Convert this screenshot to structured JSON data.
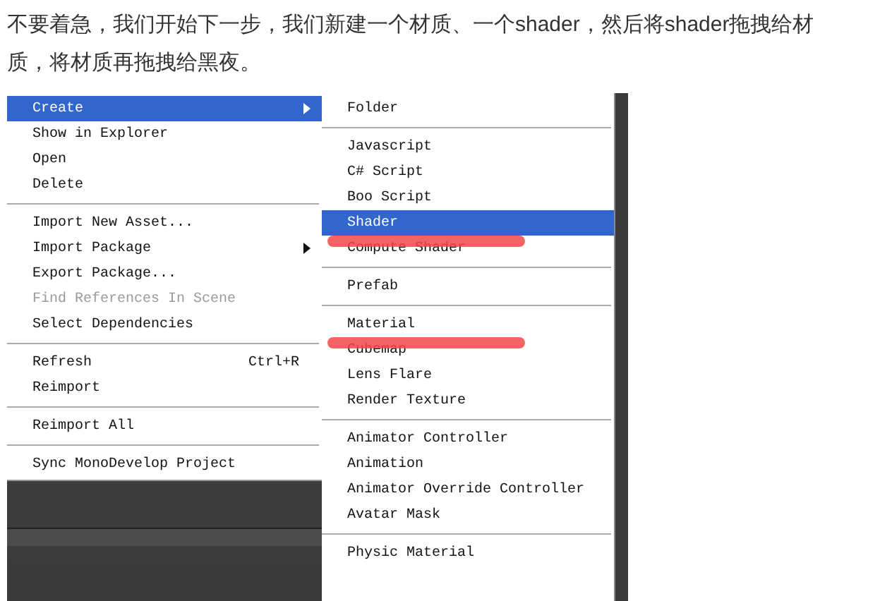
{
  "article": {
    "paragraph": "不要着急，我们开始下一步，我们新建一个材质、一个shader，然后将shader拖拽给材质，将材质再拖拽给黑夜。"
  },
  "context_menu": {
    "groups": [
      [
        {
          "label": "Create",
          "selected": true,
          "disabled": false,
          "has_submenu": true
        },
        {
          "label": "Show in Explorer",
          "selected": false,
          "disabled": false,
          "has_submenu": false
        },
        {
          "label": "Open",
          "selected": false,
          "disabled": false,
          "has_submenu": false
        },
        {
          "label": "Delete",
          "selected": false,
          "disabled": false,
          "has_submenu": false
        }
      ],
      [
        {
          "label": "Import New Asset...",
          "selected": false,
          "disabled": false,
          "has_submenu": false
        },
        {
          "label": "Import Package",
          "selected": false,
          "disabled": false,
          "has_submenu": true
        },
        {
          "label": "Export Package...",
          "selected": false,
          "disabled": false,
          "has_submenu": false
        },
        {
          "label": "Find References In Scene",
          "selected": false,
          "disabled": true,
          "has_submenu": false
        },
        {
          "label": "Select Dependencies",
          "selected": false,
          "disabled": false,
          "has_submenu": false
        }
      ],
      [
        {
          "label": "Refresh",
          "shortcut": "Ctrl+R",
          "selected": false,
          "disabled": false,
          "has_submenu": false
        },
        {
          "label": "Reimport",
          "selected": false,
          "disabled": false,
          "has_submenu": false
        }
      ],
      [
        {
          "label": "Reimport All",
          "selected": false,
          "disabled": false,
          "has_submenu": false
        }
      ],
      [
        {
          "label": "Sync MonoDevelop Project",
          "selected": false,
          "disabled": false,
          "has_submenu": false
        }
      ]
    ]
  },
  "create_submenu": {
    "groups": [
      [
        {
          "label": "Folder",
          "selected": false,
          "marked": false
        }
      ],
      [
        {
          "label": "Javascript",
          "selected": false,
          "marked": false
        },
        {
          "label": "C# Script",
          "selected": false,
          "marked": false
        },
        {
          "label": "Boo Script",
          "selected": false,
          "marked": false
        },
        {
          "label": "Shader",
          "selected": true,
          "marked": false
        },
        {
          "label": "Compute Shader",
          "selected": false,
          "marked": true
        }
      ],
      [
        {
          "label": "Prefab",
          "selected": false,
          "marked": false
        }
      ],
      [
        {
          "label": "Material",
          "selected": false,
          "marked": false
        },
        {
          "label": "Cubemap",
          "selected": false,
          "marked": true
        },
        {
          "label": "Lens Flare",
          "selected": false,
          "marked": false
        },
        {
          "label": "Render Texture",
          "selected": false,
          "marked": false
        }
      ],
      [
        {
          "label": "Animator Controller",
          "selected": false,
          "marked": false
        },
        {
          "label": "Animation",
          "selected": false,
          "marked": false
        },
        {
          "label": "Animator Override Controller",
          "selected": false,
          "marked": false
        },
        {
          "label": "Avatar Mask",
          "selected": false,
          "marked": false
        }
      ],
      [
        {
          "label": "Physic Material",
          "selected": false,
          "marked": false
        }
      ]
    ]
  }
}
